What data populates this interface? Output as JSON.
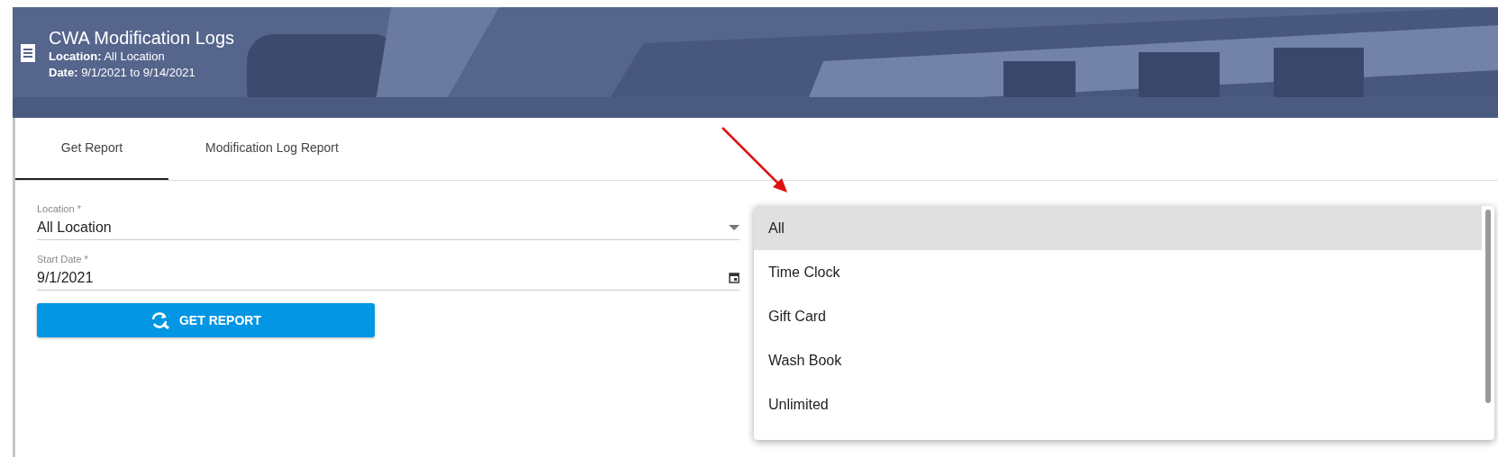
{
  "header": {
    "title": "CWA Modification Logs",
    "location_label": "Location:",
    "location_value": "All Location",
    "date_label": "Date:",
    "date_value": "9/1/2021 to 9/14/2021"
  },
  "tabs": [
    {
      "label": "Get Report",
      "selected": true
    },
    {
      "label": "Modification Log Report",
      "selected": false
    }
  ],
  "form": {
    "location": {
      "label": "Location *",
      "value": "All Location"
    },
    "start_date": {
      "label": "Start Date *",
      "value": "9/1/2021"
    },
    "button": "GET REPORT"
  },
  "report_type_menu": [
    {
      "label": "All",
      "selected": true
    },
    {
      "label": "Time Clock",
      "selected": false
    },
    {
      "label": "Gift Card",
      "selected": false
    },
    {
      "label": "Wash Book",
      "selected": false
    },
    {
      "label": "Unlimited",
      "selected": false
    }
  ]
}
